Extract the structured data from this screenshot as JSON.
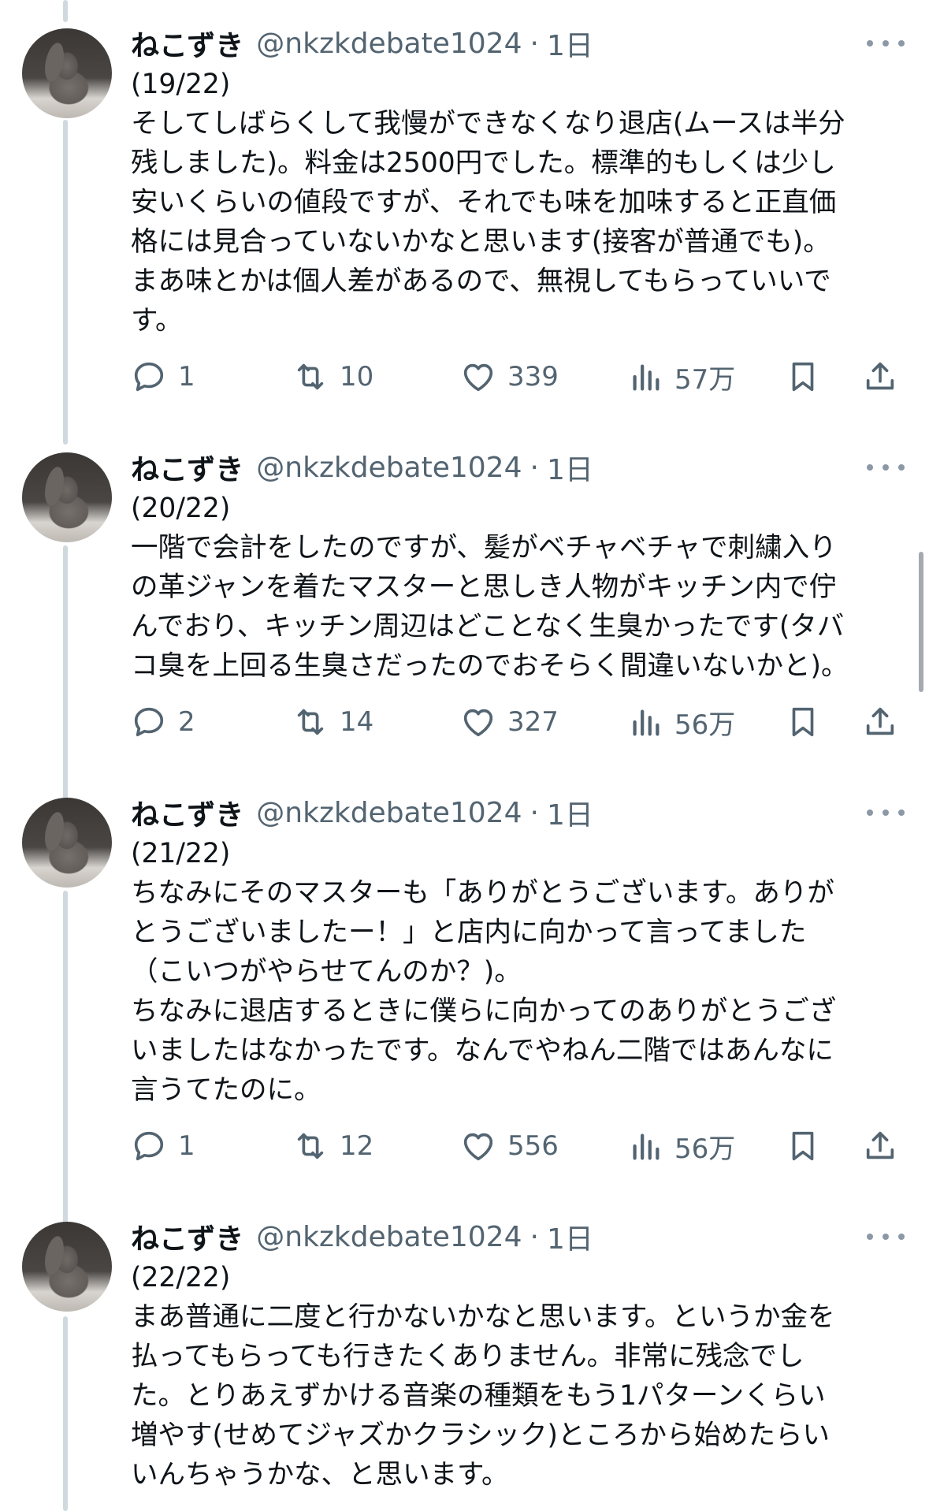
{
  "tweets": [
    {
      "name": "ねこずき",
      "handle": "@nkzkdebate1024",
      "separator": "·",
      "time": "1日",
      "lines": [
        "(19/22)",
        "そしてしばらくして我慢ができなくなり退店(ムースは半分",
        "残しました)。料金は2500円でした。標準的もしくは少し",
        "安いくらいの値段ですが、それでも味を加味すると正直価",
        "格には見合っていないかなと思います(接客が普通でも)。",
        "まあ味とかは個人差があるので、無視してもらっていいで",
        "す。"
      ],
      "replies": "1",
      "retweets": "10",
      "likes": "339",
      "views": "57万"
    },
    {
      "name": "ねこずき",
      "handle": "@nkzkdebate1024",
      "separator": "·",
      "time": "1日",
      "lines": [
        "(20/22)",
        "一階で会計をしたのですが、髪がベチャベチャで刺繍入り",
        "の革ジャンを着たマスターと思しき人物がキッチン内で佇",
        "んでおり、キッチン周辺はどことなく生臭かったです(タバ",
        "コ臭を上回る生臭さだったのでおそらく間違いないかと)。"
      ],
      "replies": "2",
      "retweets": "14",
      "likes": "327",
      "views": "56万"
    },
    {
      "name": "ねこずき",
      "handle": "@nkzkdebate1024",
      "separator": "·",
      "time": "1日",
      "lines": [
        "(21/22)",
        "ちなみにそのマスターも「ありがとうございます。ありが",
        "とうございましたー！」と店内に向かって言ってました",
        "（こいつがやらせてんのか？)。",
        "ちなみに退店するときに僕らに向かってのありがとうござ",
        "いましたはなかったです。なんでやねん二階ではあんなに",
        "言うてたのに。"
      ],
      "replies": "1",
      "retweets": "12",
      "likes": "556",
      "views": "56万"
    },
    {
      "name": "ねこずき",
      "handle": "@nkzkdebate1024",
      "separator": "·",
      "time": "1日",
      "lines": [
        "(22/22)",
        "まあ普通に二度と行かないかなと思います。というか金を",
        "払ってもらっても行きたくありません。非常に残念でし",
        "た。とりあえずかける音楽の種類をもう1パターンくらい",
        "増やす(せめてジャズかクラシック)ところから始めたらい",
        "いんちゃうかな、と思います。"
      ]
    }
  ],
  "icons": {
    "reply": "reply-icon",
    "retweet": "retweet-icon",
    "like": "heart-icon",
    "views": "views-icon",
    "bookmark": "bookmark-icon",
    "share": "share-icon",
    "more": "more-icon"
  },
  "colors": {
    "text": "#0f1419",
    "secondary": "#536471",
    "thread_line": "#cfd9de"
  }
}
